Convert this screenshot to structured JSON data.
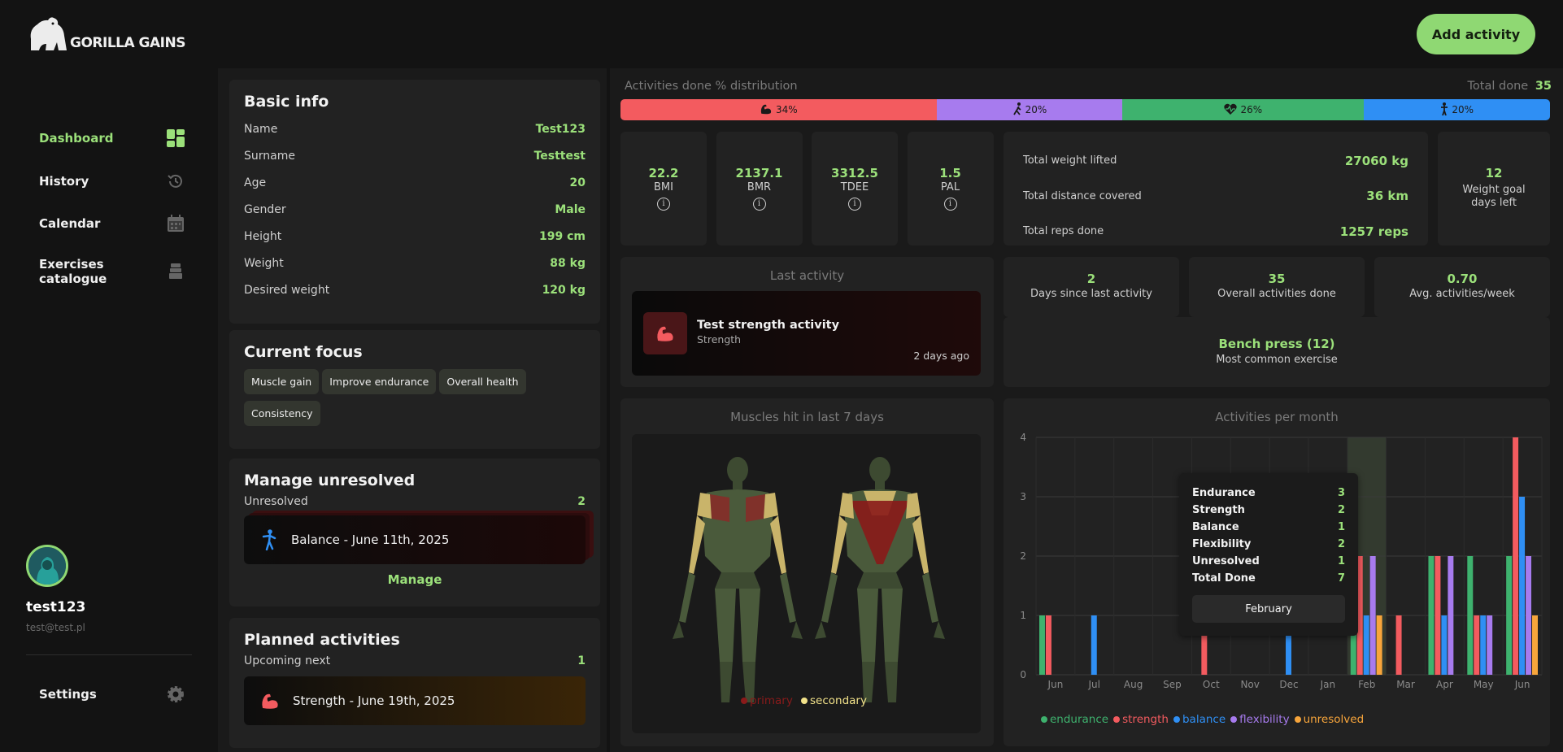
{
  "app": {
    "name": "GORILLA GAINS",
    "add_activity": "Add activity"
  },
  "nav": {
    "items": [
      {
        "label": "Dashboard",
        "icon": "dashboard-icon",
        "active": true
      },
      {
        "label": "History",
        "icon": "history-icon"
      },
      {
        "label": "Calendar",
        "icon": "calendar-icon"
      },
      {
        "label": "Exercises catalogue",
        "icon": "weights-icon"
      }
    ],
    "settings": "Settings"
  },
  "user": {
    "name": "test123",
    "email": "test@test.pl"
  },
  "basic_info": {
    "title": "Basic info",
    "rows": [
      {
        "label": "Name",
        "value": "Test123"
      },
      {
        "label": "Surname",
        "value": "Testtest"
      },
      {
        "label": "Age",
        "value": "20"
      },
      {
        "label": "Gender",
        "value": "Male"
      },
      {
        "label": "Height",
        "value": "199 cm"
      },
      {
        "label": "Weight",
        "value": "88 kg"
      },
      {
        "label": "Desired weight",
        "value": "120 kg"
      }
    ]
  },
  "focus": {
    "title": "Current focus",
    "chips": [
      "Muscle gain",
      "Improve endurance",
      "Overall health",
      "Consistency"
    ]
  },
  "unresolved": {
    "title": "Manage unresolved",
    "label": "Unresolved",
    "count": "2",
    "item": "Balance - June 11th, 2025",
    "manage": "Manage"
  },
  "planned": {
    "title": "Planned activities",
    "label": "Upcoming next",
    "count": "1",
    "item": "Strength - June 19th, 2025"
  },
  "distribution": {
    "title": "Activities done % distribution",
    "total_label": "Total done",
    "total": "35",
    "segments": [
      {
        "label": "34%",
        "value": 34,
        "color": "#f35b5f",
        "icon": "strength-icon"
      },
      {
        "label": "20%",
        "value": 20,
        "color": "#a77bee",
        "icon": "flexibility-icon"
      },
      {
        "label": "26%",
        "value": 26,
        "color": "#3eb26e",
        "icon": "endurance-icon"
      },
      {
        "label": "20%",
        "value": 20,
        "color": "#2f8ff4",
        "icon": "balance-icon"
      }
    ]
  },
  "metrics": [
    {
      "value": "22.2",
      "label": "BMI"
    },
    {
      "value": "2137.1",
      "label": "BMR"
    },
    {
      "value": "3312.5",
      "label": "TDEE"
    },
    {
      "value": "1.5",
      "label": "PAL"
    }
  ],
  "totals": [
    {
      "label": "Total weight lifted",
      "value": "27060 kg"
    },
    {
      "label": "Total distance covered",
      "value": "36 km"
    },
    {
      "label": "Total reps done",
      "value": "1257 reps"
    }
  ],
  "goal": {
    "value": "12",
    "label": "Weight goal days left"
  },
  "last_activity": {
    "title": "Last activity",
    "name": "Test strength activity",
    "type": "Strength",
    "ago": "2 days ago"
  },
  "quick_stats": [
    {
      "value": "2",
      "label": "Days since last activity"
    },
    {
      "value": "35",
      "label": "Overall activities done"
    },
    {
      "value": "0.70",
      "label": "Avg. activities/week"
    }
  ],
  "common_exercise": {
    "value": "Bench press (12)",
    "label": "Most common exercise"
  },
  "muscles": {
    "title": "Muscles hit in last 7 days",
    "legend": [
      {
        "label": "primary",
        "color": "#8a1a1a"
      },
      {
        "label": "secondary",
        "color": "#f2e28a"
      }
    ]
  },
  "chart_data": {
    "type": "bar",
    "title": "Activities per month",
    "categories": [
      "Jun",
      "Jul",
      "Aug",
      "Sep",
      "Oct",
      "Nov",
      "Dec",
      "Jan",
      "Feb",
      "Mar",
      "Apr",
      "May",
      "Jun"
    ],
    "ylim": [
      0,
      4
    ],
    "yticks": [
      0,
      1,
      2,
      3,
      4
    ],
    "grid": true,
    "legend_position": "bottom",
    "highlighted_category": "Feb",
    "series": [
      {
        "name": "endurance",
        "color": "#3eb26e",
        "values": [
          1,
          0,
          0,
          0,
          0,
          0,
          0,
          0,
          3,
          0,
          2,
          2,
          2
        ]
      },
      {
        "name": "strength",
        "color": "#f35b5f",
        "values": [
          1,
          0,
          0,
          0,
          1,
          0,
          0,
          0,
          2,
          1,
          2,
          1,
          4
        ]
      },
      {
        "name": "balance",
        "color": "#2f8ff4",
        "values": [
          0,
          1,
          0,
          0,
          0,
          0,
          1,
          0,
          1,
          0,
          1,
          1,
          3
        ]
      },
      {
        "name": "flexibility",
        "color": "#a77bee",
        "values": [
          0,
          0,
          0,
          0,
          0,
          0,
          0,
          0,
          2,
          0,
          2,
          1,
          2
        ]
      },
      {
        "name": "unresolved",
        "color": "#f7a53b",
        "values": [
          0,
          0,
          0,
          0,
          0,
          0,
          0,
          0,
          1,
          0,
          0,
          0,
          1
        ]
      }
    ],
    "tooltip": {
      "rows": [
        {
          "label": "Endurance",
          "value": "3"
        },
        {
          "label": "Strength",
          "value": "2"
        },
        {
          "label": "Balance",
          "value": "1"
        },
        {
          "label": "Flexibility",
          "value": "2"
        },
        {
          "label": "Unresolved",
          "value": "1"
        },
        {
          "label": "Total Done",
          "value": "7"
        }
      ],
      "footer": "February"
    }
  }
}
